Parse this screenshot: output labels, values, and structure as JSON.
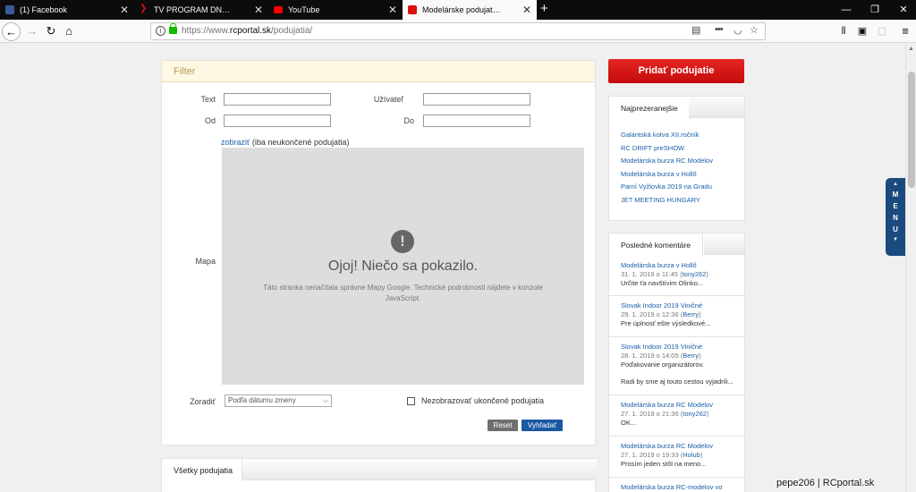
{
  "browser": {
    "tabs": [
      {
        "title": "(1) Facebook",
        "favicon": "facebook-icon",
        "color": "#3b5998"
      },
      {
        "title": "TV PROGRAM DNES, aktuálny",
        "favicon": "tvprogram-icon",
        "color": "#d9100f"
      },
      {
        "title": "YouTube",
        "favicon": "youtube-icon",
        "color": "#ff0000"
      },
      {
        "title": "Modelárske podujatia a stretnu",
        "favicon": "rcportal-icon",
        "color": "#d9100f"
      }
    ],
    "new_tab": "+",
    "window_controls": {
      "minimize": "—",
      "restore": "❐",
      "close": "✕"
    },
    "url_scheme": "https://www.",
    "url_host": "rcportal.sk",
    "url_path": "/podujatia/",
    "more_label": "•••"
  },
  "filter": {
    "title": "Filter",
    "text_label": "Text",
    "user_label": "Užívateľ",
    "from_label": "Od",
    "to_label": "Do",
    "show_link": "zobraziť",
    "show_suffix": " (iba neukončené podujatia)",
    "map_label": "Mapa",
    "map_error_title": "Ojoj! Niečo sa pokazilo.",
    "map_error_msg": "Táto stránka nenačítala správne Mapy Google. Technické podrobnosti nájdete v konzole JavaScript.",
    "sort_label": "Zoradiť",
    "sort_value": "Podľa dátumu zmeny",
    "hide_finished_label": "Nezobrazovať ukončené podujatia",
    "reset_label": "Reset",
    "search_label": "Vyhľadať"
  },
  "all_events": {
    "tab_label": "Všetky podujatia"
  },
  "sidebar": {
    "add_button": "Pridať podujatie",
    "popular_title": "Najprezeranejšie",
    "popular": [
      "Galantská kotva XII.ročník",
      "RC DRIFT preSHOW",
      "Modelárska burza RC Modelov",
      "Modelárska burza v Hollő",
      "Parní Vyžlovka 2019 na Gradu",
      "JET MEETING HUNGARY"
    ],
    "comments_title": "Posledné komentáre",
    "comments": [
      {
        "title": "Modelárska burza v Hollő",
        "date": "31. 1. 2019 o 11:45",
        "user": "tony262",
        "text": "Určite ťa navštívim Olinko..."
      },
      {
        "title": "Slovak Indoor 2019 Viničné",
        "date": "29. 1. 2019 o 12:36",
        "user": "Berry",
        "text": "Pre úplnosť ešte výsledkové..."
      },
      {
        "title": "Slovak Indoor 2019 Viničné",
        "date": "28. 1. 2019 o 14:05",
        "user": "Berry",
        "text": "Poďakovanie organizátorov.",
        "text2": "Radi by sme aj touto cestou vyjadrili..."
      },
      {
        "title": "Modelárska burza RC Modelov",
        "date": "27. 1. 2019 o 21:36",
        "user": "tony262",
        "text": "OK..."
      },
      {
        "title": "Modelárska burza RC Modelov",
        "date": "27. 1. 2019 o 19:33",
        "user": "Holub",
        "text": "Prosím jeden stôl na meno..."
      },
      {
        "title": "Modelárska burza RC-modelov vo",
        "date": "",
        "user": "",
        "text": ""
      }
    ]
  },
  "menu_letters": [
    "M",
    "E",
    "N",
    "U"
  ],
  "watermark": "pepe206 | RCportal.sk"
}
